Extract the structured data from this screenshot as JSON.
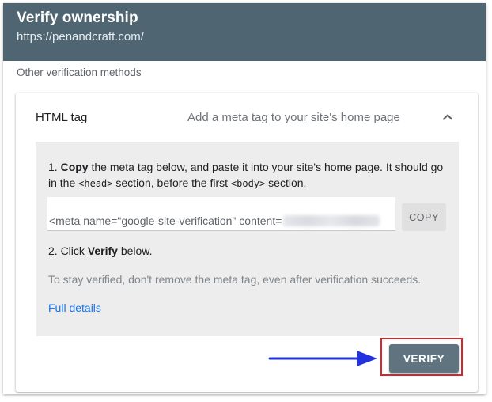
{
  "header": {
    "title": "Verify ownership",
    "url": "https://penandcraft.com/"
  },
  "section_label": "Other verification methods",
  "method": {
    "title": "HTML tag",
    "description": "Add a meta tag to your site's home page",
    "chevron_icon": "chevron-up-icon"
  },
  "instructions": {
    "step1_prefix": "1. ",
    "step1_bold": "Copy",
    "step1_rest": " the meta tag below, and paste it into your site's home page. It should go in the ",
    "head_tag": "<head>",
    "step1_middle": " section, before the first ",
    "body_tag": "<body>",
    "step1_end": " section.",
    "meta_tag": "<meta name=\"google-site-verification\" content=",
    "copy_label": "COPY",
    "step2_prefix": "2. Click ",
    "step2_bold": "Verify",
    "step2_rest": " below.",
    "stay_verified": "To stay verified, don't remove the meta tag, even after verification succeeds.",
    "full_details": "Full details"
  },
  "verify_label": "VERIFY",
  "colors": {
    "header_bg": "#4f6571",
    "link": "#1a73e8",
    "verify_bg": "#5f747f",
    "highlight_border": "#d9252a",
    "arrow": "#2233dd"
  }
}
